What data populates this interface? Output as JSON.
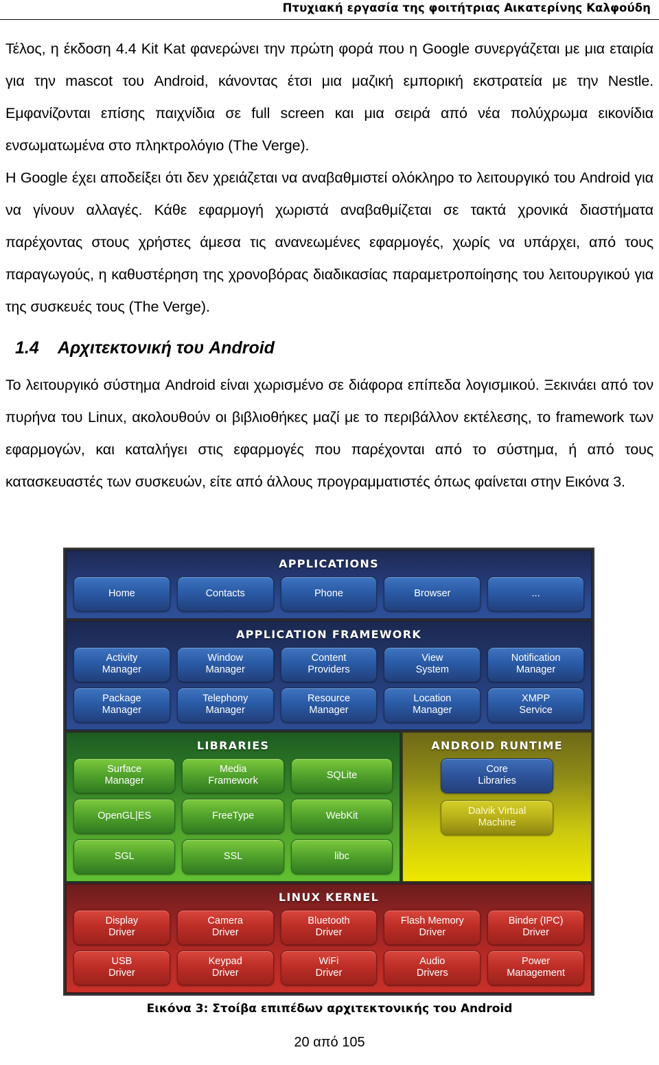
{
  "header": {
    "running_title": "Πτυχιακή εργασία της φοιτήτριας Αικατερίνης Καλφούδη"
  },
  "body": {
    "paragraph1": "Τέλος, η έκδοση 4.4 Kit Kat φανερώνει την πρώτη φορά που η Google συνεργάζεται με μια εταιρία για την mascot του Android, κάνοντας έτσι μια μαζική εμπορική εκστρατεία με την Nestle. Εμφανίζονται επίσης παιχνίδια σε full screen και μια σειρά από νέα πολύχρωμα εικονίδια ενσωματωμένα στο πληκτρολόγιο (The Verge).",
    "paragraph2": "Η Google έχει αποδείξει ότι δεν χρειάζεται να αναβαθμιστεί ολόκληρο το λειτουργικό του Android για να γίνουν αλλαγές. Κάθε εφαρμογή χωριστά αναβαθμίζεται σε τακτά χρονικά διαστήματα παρέχοντας στους χρήστες άμεσα τις ανανεωμένες εφαρμογές, χωρίς να υπάρχει, από τους παραγωγούς, η καθυστέρηση της χρονοβόρας διαδικασίας παραμετροποίησης του λειτουργικού για της συσκευές τους (The Verge).",
    "section_number": "1.4",
    "section_title": "Αρχιτεκτονική του Android",
    "paragraph3": "Το λειτουργικό σύστημα Android είναι χωρισμένο σε διάφορα επίπεδα λογισμικού. Ξεκινάει από τον πυρήνα του Linux, ακολουθούν οι βιβλιοθήκες μαζί με το περιβάλλον εκτέλεσης, το framework των εφαρμογών, και καταλήγει στις εφαρμογές που παρέχονται από το σύστημα, ή από τους κατασκευαστές των συσκευών, είτε από άλλους προγραμματιστές όπως φαίνεται στην Εικόνα 3."
  },
  "figure": {
    "caption": "Εικόνα 3: Στοίβα επιπέδων αρχιτεκτονικής του Android",
    "layers": [
      {
        "id": "applications",
        "title": "Applications",
        "color": "#2a4a90",
        "rows": [
          [
            "Home",
            "Contacts",
            "Phone",
            "Browser",
            "..."
          ]
        ]
      },
      {
        "id": "application-framework",
        "title": "Application Framework",
        "color": "#2c4c93",
        "rows": [
          [
            "Activity\nManager",
            "Window\nManager",
            "Content\nProviders",
            "View\nSystem",
            "Notification\nManager"
          ],
          [
            "Package\nManager",
            "Telephony\nManager",
            "Resource\nManager",
            "Location\nManager",
            "XMPP\nService"
          ]
        ]
      },
      {
        "id": "libraries",
        "title": "Libraries",
        "color": "#4fa32c",
        "rows": [
          [
            "Surface\nManager",
            "Media\nFramework",
            "SQLite"
          ],
          [
            "OpenGL|ES",
            "FreeType",
            "WebKit"
          ],
          [
            "SGL",
            "SSL",
            "libc"
          ]
        ]
      },
      {
        "id": "android-runtime",
        "title": "Android Runtime",
        "color": "#c9c70f",
        "rows": [
          [
            "Core\nLibraries"
          ],
          [
            "Dalvik Virtual\nMachine"
          ]
        ]
      },
      {
        "id": "linux-kernel",
        "title": "Linux Kernel",
        "color": "#b52a26",
        "rows": [
          [
            "Display\nDriver",
            "Camera\nDriver",
            "Bluetooth\nDriver",
            "Flash Memory\nDriver",
            "Binder (IPC)\nDriver"
          ],
          [
            "USB\nDriver",
            "Keypad\nDriver",
            "WiFi\nDriver",
            "Audio\nDrivers",
            "Power\nManagement"
          ]
        ]
      }
    ],
    "cells": {
      "apps": {
        "home": "Home",
        "contacts": "Contacts",
        "phone": "Phone",
        "browser": "Browser",
        "more": "..."
      },
      "framework": {
        "activity_manager_l1": "Activity",
        "activity_manager_l2": "Manager",
        "window_manager_l1": "Window",
        "window_manager_l2": "Manager",
        "content_providers_l1": "Content",
        "content_providers_l2": "Providers",
        "view_system_l1": "View",
        "view_system_l2": "System",
        "notification_manager_l1": "Notification",
        "notification_manager_l2": "Manager",
        "package_manager_l1": "Package",
        "package_manager_l2": "Manager",
        "telephony_manager_l1": "Telephony",
        "telephony_manager_l2": "Manager",
        "resource_manager_l1": "Resource",
        "resource_manager_l2": "Manager",
        "location_manager_l1": "Location",
        "location_manager_l2": "Manager",
        "xmpp_service_l1": "XMPP",
        "xmpp_service_l2": "Service"
      },
      "libraries": {
        "surface_manager_l1": "Surface",
        "surface_manager_l2": "Manager",
        "media_framework_l1": "Media",
        "media_framework_l2": "Framework",
        "sqlite": "SQLite",
        "opengles": "OpenGL|ES",
        "freetype": "FreeType",
        "webkit": "WebKit",
        "sgl": "SGL",
        "ssl": "SSL",
        "libc": "libc"
      },
      "runtime": {
        "core_libraries_l1": "Core",
        "core_libraries_l2": "Libraries",
        "dalvik_l1": "Dalvik Virtual",
        "dalvik_l2": "Machine"
      },
      "kernel": {
        "display_driver_l1": "Display",
        "display_driver_l2": "Driver",
        "camera_driver_l1": "Camera",
        "camera_driver_l2": "Driver",
        "bluetooth_driver_l1": "Bluetooth",
        "bluetooth_driver_l2": "Driver",
        "flash_memory_driver_l1": "Flash Memory",
        "flash_memory_driver_l2": "Driver",
        "binder_driver_l1": "Binder (IPC)",
        "binder_driver_l2": "Driver",
        "usb_driver_l1": "USB",
        "usb_driver_l2": "Driver",
        "keypad_driver_l1": "Keypad",
        "keypad_driver_l2": "Driver",
        "wifi_driver_l1": "WiFi",
        "wifi_driver_l2": "Driver",
        "audio_drivers_l1": "Audio",
        "audio_drivers_l2": "Drivers",
        "power_management_l1": "Power",
        "power_management_l2": "Management"
      }
    },
    "titles": {
      "applications": "Applications",
      "application_framework": "Application Framework",
      "libraries": "Libraries",
      "android_runtime": "Android Runtime",
      "linux_kernel": "Linux Kernel"
    }
  },
  "footer": {
    "page_number": "20 από 105"
  }
}
